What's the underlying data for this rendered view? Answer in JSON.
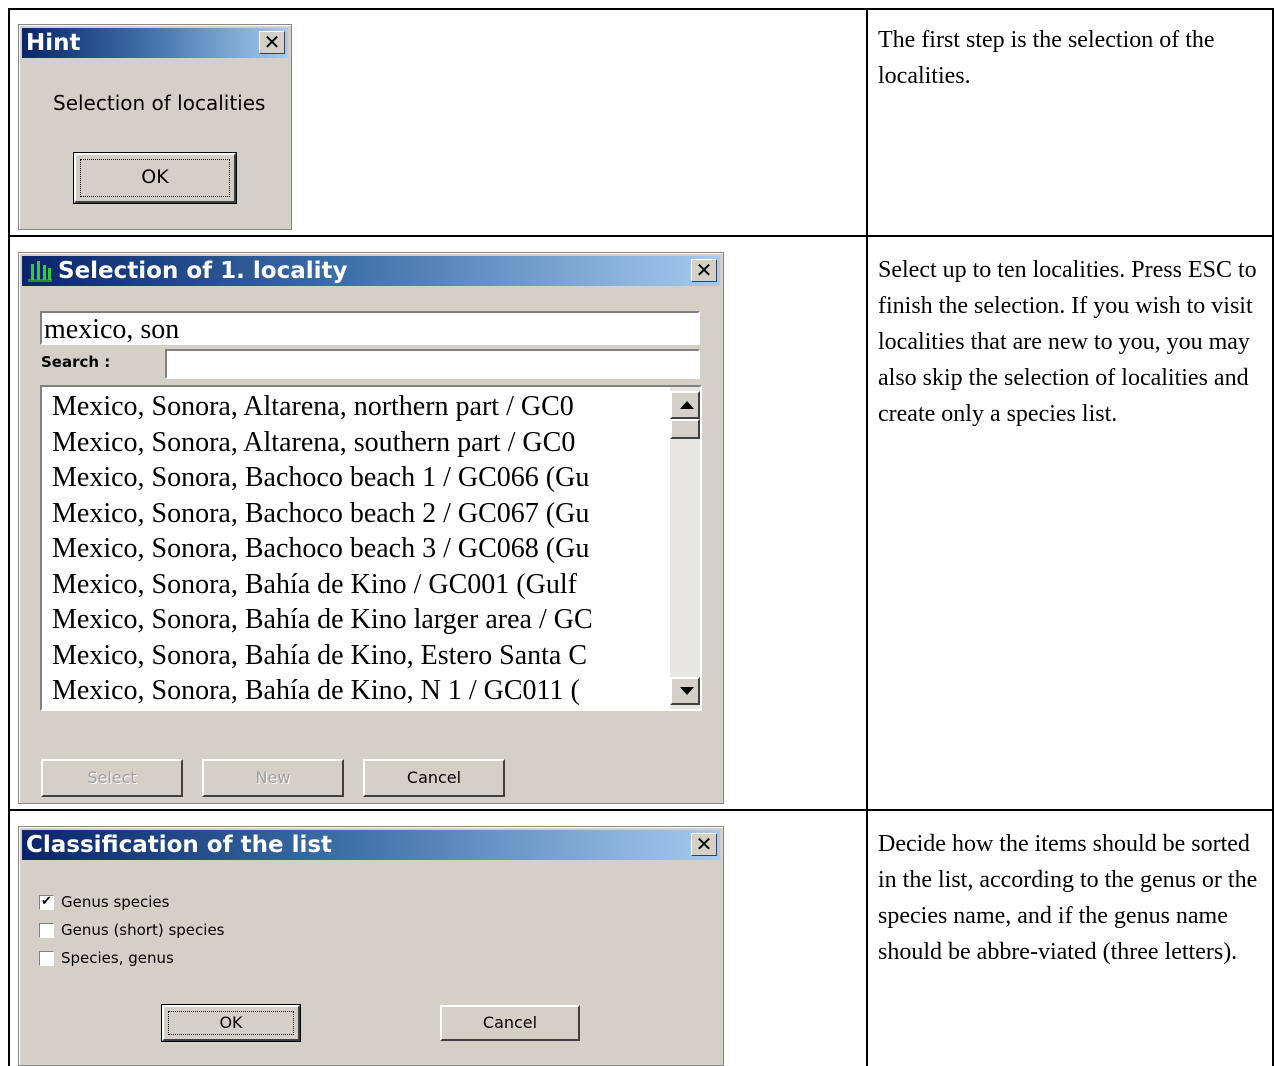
{
  "row1": {
    "dialog": {
      "title": "Hint",
      "close": "✕",
      "message": "Selection of localities",
      "ok": "OK"
    },
    "description": "The first step is the selection of the localities."
  },
  "row2": {
    "dialog": {
      "title": "Selection of 1. locality",
      "close": "✕",
      "query_value": "mexico, son",
      "search_label": "Search :",
      "search_value": "",
      "items": [
        "Mexico, Sonora, Altarena, northern part / GC0",
        "Mexico, Sonora, Altarena, southern part / GC0",
        "Mexico, Sonora, Bachoco beach 1 / GC066 (Gu",
        "Mexico, Sonora, Bachoco beach 2 / GC067 (Gu",
        "Mexico, Sonora, Bachoco beach 3 / GC068 (Gu",
        "Mexico, Sonora, Bahía de Kino / GC001 (Gulf",
        "Mexico, Sonora, Bahía de Kino larger area / GC",
        "Mexico, Sonora, Bahía de Kino, Estero Santa C",
        "Mexico, Sonora, Bahía de Kino, N 1 / GC011 ("
      ],
      "select_btn": "Select",
      "new_btn": "New",
      "cancel_btn": "Cancel"
    },
    "description": "Select up to ten localities. Press ESC to finish the selection. If you wish to visit localities that are new to you, you may also skip the selection of localities and create only a species list."
  },
  "row3": {
    "dialog": {
      "title": "Classification of the list",
      "close": "✕",
      "options": [
        {
          "label": "Genus species",
          "checked": true
        },
        {
          "label": "Genus (short) species",
          "checked": false
        },
        {
          "label": "Species, genus",
          "checked": false
        }
      ],
      "ok": "OK",
      "cancel": "Cancel"
    },
    "description": "Decide how the items should be sorted in the list, according to the genus or the species name, and if the genus name should be abbre-viated (three letters)."
  }
}
